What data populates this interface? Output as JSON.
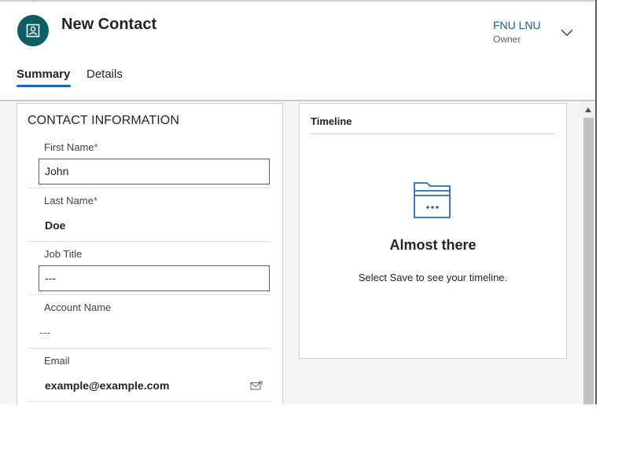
{
  "header": {
    "title": "New Contact",
    "owner_name": "FNU LNU",
    "owner_label": "Owner"
  },
  "tabs": [
    {
      "label": "Summary",
      "active": true
    },
    {
      "label": "Details",
      "active": false
    }
  ],
  "contact_section": {
    "title": "CONTACT INFORMATION",
    "fields": {
      "first_name": {
        "label": "First Name",
        "required_mark": "*",
        "value": "John"
      },
      "last_name": {
        "label": "Last Name",
        "required_mark": "*",
        "value": "Doe"
      },
      "job_title": {
        "label": "Job Title",
        "value": "---"
      },
      "account_name": {
        "label": "Account Name",
        "value": "---"
      },
      "email": {
        "label": "Email",
        "value": "example@example.com"
      }
    }
  },
  "timeline": {
    "title": "Timeline",
    "empty_heading": "Almost there",
    "empty_message": "Select Save to see your timeline."
  },
  "colors": {
    "accent": "#0f6cbd",
    "avatar_bg": "#0b5e63",
    "owner_link": "#115ea3",
    "required": "#c4314b"
  },
  "icons": {
    "avatar": "contact-card-icon",
    "owner_toggle": "chevron-down-icon",
    "email_action": "send-email-icon",
    "timeline_empty": "folder-icon"
  }
}
